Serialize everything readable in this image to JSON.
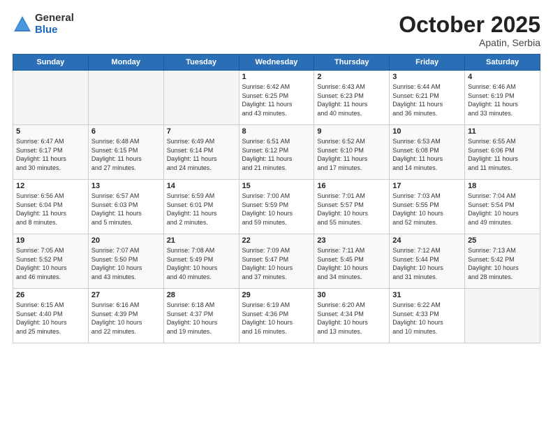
{
  "header": {
    "logo_general": "General",
    "logo_blue": "Blue",
    "month": "October 2025",
    "location": "Apatin, Serbia"
  },
  "weekdays": [
    "Sunday",
    "Monday",
    "Tuesday",
    "Wednesday",
    "Thursday",
    "Friday",
    "Saturday"
  ],
  "weeks": [
    [
      {
        "day": "",
        "info": ""
      },
      {
        "day": "",
        "info": ""
      },
      {
        "day": "",
        "info": ""
      },
      {
        "day": "1",
        "info": "Sunrise: 6:42 AM\nSunset: 6:25 PM\nDaylight: 11 hours\nand 43 minutes."
      },
      {
        "day": "2",
        "info": "Sunrise: 6:43 AM\nSunset: 6:23 PM\nDaylight: 11 hours\nand 40 minutes."
      },
      {
        "day": "3",
        "info": "Sunrise: 6:44 AM\nSunset: 6:21 PM\nDaylight: 11 hours\nand 36 minutes."
      },
      {
        "day": "4",
        "info": "Sunrise: 6:46 AM\nSunset: 6:19 PM\nDaylight: 11 hours\nand 33 minutes."
      }
    ],
    [
      {
        "day": "5",
        "info": "Sunrise: 6:47 AM\nSunset: 6:17 PM\nDaylight: 11 hours\nand 30 minutes."
      },
      {
        "day": "6",
        "info": "Sunrise: 6:48 AM\nSunset: 6:15 PM\nDaylight: 11 hours\nand 27 minutes."
      },
      {
        "day": "7",
        "info": "Sunrise: 6:49 AM\nSunset: 6:14 PM\nDaylight: 11 hours\nand 24 minutes."
      },
      {
        "day": "8",
        "info": "Sunrise: 6:51 AM\nSunset: 6:12 PM\nDaylight: 11 hours\nand 21 minutes."
      },
      {
        "day": "9",
        "info": "Sunrise: 6:52 AM\nSunset: 6:10 PM\nDaylight: 11 hours\nand 17 minutes."
      },
      {
        "day": "10",
        "info": "Sunrise: 6:53 AM\nSunset: 6:08 PM\nDaylight: 11 hours\nand 14 minutes."
      },
      {
        "day": "11",
        "info": "Sunrise: 6:55 AM\nSunset: 6:06 PM\nDaylight: 11 hours\nand 11 minutes."
      }
    ],
    [
      {
        "day": "12",
        "info": "Sunrise: 6:56 AM\nSunset: 6:04 PM\nDaylight: 11 hours\nand 8 minutes."
      },
      {
        "day": "13",
        "info": "Sunrise: 6:57 AM\nSunset: 6:03 PM\nDaylight: 11 hours\nand 5 minutes."
      },
      {
        "day": "14",
        "info": "Sunrise: 6:59 AM\nSunset: 6:01 PM\nDaylight: 11 hours\nand 2 minutes."
      },
      {
        "day": "15",
        "info": "Sunrise: 7:00 AM\nSunset: 5:59 PM\nDaylight: 10 hours\nand 59 minutes."
      },
      {
        "day": "16",
        "info": "Sunrise: 7:01 AM\nSunset: 5:57 PM\nDaylight: 10 hours\nand 55 minutes."
      },
      {
        "day": "17",
        "info": "Sunrise: 7:03 AM\nSunset: 5:55 PM\nDaylight: 10 hours\nand 52 minutes."
      },
      {
        "day": "18",
        "info": "Sunrise: 7:04 AM\nSunset: 5:54 PM\nDaylight: 10 hours\nand 49 minutes."
      }
    ],
    [
      {
        "day": "19",
        "info": "Sunrise: 7:05 AM\nSunset: 5:52 PM\nDaylight: 10 hours\nand 46 minutes."
      },
      {
        "day": "20",
        "info": "Sunrise: 7:07 AM\nSunset: 5:50 PM\nDaylight: 10 hours\nand 43 minutes."
      },
      {
        "day": "21",
        "info": "Sunrise: 7:08 AM\nSunset: 5:49 PM\nDaylight: 10 hours\nand 40 minutes."
      },
      {
        "day": "22",
        "info": "Sunrise: 7:09 AM\nSunset: 5:47 PM\nDaylight: 10 hours\nand 37 minutes."
      },
      {
        "day": "23",
        "info": "Sunrise: 7:11 AM\nSunset: 5:45 PM\nDaylight: 10 hours\nand 34 minutes."
      },
      {
        "day": "24",
        "info": "Sunrise: 7:12 AM\nSunset: 5:44 PM\nDaylight: 10 hours\nand 31 minutes."
      },
      {
        "day": "25",
        "info": "Sunrise: 7:13 AM\nSunset: 5:42 PM\nDaylight: 10 hours\nand 28 minutes."
      }
    ],
    [
      {
        "day": "26",
        "info": "Sunrise: 6:15 AM\nSunset: 4:40 PM\nDaylight: 10 hours\nand 25 minutes."
      },
      {
        "day": "27",
        "info": "Sunrise: 6:16 AM\nSunset: 4:39 PM\nDaylight: 10 hours\nand 22 minutes."
      },
      {
        "day": "28",
        "info": "Sunrise: 6:18 AM\nSunset: 4:37 PM\nDaylight: 10 hours\nand 19 minutes."
      },
      {
        "day": "29",
        "info": "Sunrise: 6:19 AM\nSunset: 4:36 PM\nDaylight: 10 hours\nand 16 minutes."
      },
      {
        "day": "30",
        "info": "Sunrise: 6:20 AM\nSunset: 4:34 PM\nDaylight: 10 hours\nand 13 minutes."
      },
      {
        "day": "31",
        "info": "Sunrise: 6:22 AM\nSunset: 4:33 PM\nDaylight: 10 hours\nand 10 minutes."
      },
      {
        "day": "",
        "info": ""
      }
    ]
  ]
}
